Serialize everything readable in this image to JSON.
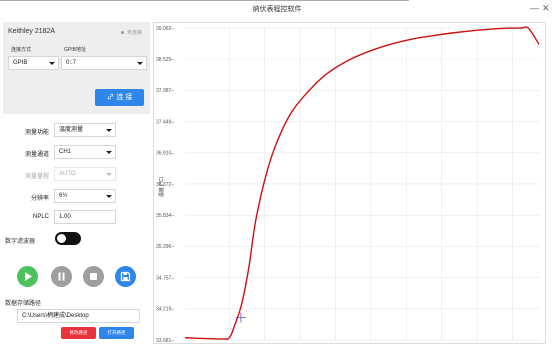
{
  "window": {
    "title": "纳伏表程控软件",
    "minimize_glyph": "—",
    "close_glyph": "✕"
  },
  "device": {
    "name": "Keithley 2182A",
    "status": "未连接",
    "connection_type_label": "连接方式",
    "connection_type_value": "GPIB",
    "gpib_address_label": "GPIB地址",
    "gpib_address_value": "0::7",
    "connect_button": "连 接",
    "connect_icon": "link-icon"
  },
  "settings": {
    "function_label": "测量功能",
    "function_value": "温度测量",
    "channel_label": "测量通道",
    "channel_value": "CH1",
    "range_label": "测量量程",
    "range_value": "AUTO",
    "resolution_label": "分辨率",
    "resolution_value": "6½",
    "nplc_label": "NPLC",
    "nplc_value": "1.00",
    "digital_filter_label": "数字滤波器",
    "digital_filter_on": false
  },
  "controls": {
    "play_color": "#4cc15c",
    "pause_color": "#9e9e9e",
    "stop_color": "#9e9e9e",
    "save_color": "#2f86ea"
  },
  "storage": {
    "path_label": "数据存储路径",
    "path_value": "C:\\Users\\柄建成\\Desktop",
    "select_path_button": "修改路径",
    "open_path_button": "打开路径",
    "select_color": "#e8333a",
    "open_color": "#2f86ea"
  },
  "chart_data": {
    "type": "line",
    "ylabel": "温度 (°C)",
    "ylim": [
      33.681,
      39.062
    ],
    "yticks": [
      33.681,
      34.219,
      34.757,
      35.296,
      35.834,
      36.372,
      36.91,
      37.449,
      37.987,
      38.525,
      39.062
    ],
    "ytick_labels": [
      "33.681",
      "34.219",
      "34.757",
      "35.296",
      "35.834",
      "36.372",
      "36.910",
      "37.449",
      "37.987",
      "38.525",
      "39.062"
    ],
    "xlim": [
      0,
      100
    ],
    "xticks": [
      12.5,
      22.5,
      32.5,
      42.5,
      52.5,
      62.5,
      72.5,
      82.5,
      92.5
    ],
    "grid": true,
    "line_color": "#cc1111",
    "marker_point": [
      15.8,
      34.07
    ],
    "marker_color": "#6a4fc9",
    "series": [
      {
        "x": [
          0,
          10,
          12.5,
          14,
          16,
          18,
          20,
          23,
          26,
          30,
          35,
          40,
          46,
          52,
          58,
          64,
          70,
          76,
          82,
          88,
          92,
          95,
          97,
          100
        ],
        "y": [
          33.72,
          33.7,
          33.72,
          33.93,
          34.3,
          34.92,
          35.75,
          36.55,
          37.1,
          37.6,
          37.98,
          38.27,
          38.5,
          38.66,
          38.78,
          38.87,
          38.93,
          38.98,
          39.02,
          39.05,
          39.06,
          39.06,
          39.06,
          38.78
        ]
      }
    ]
  }
}
